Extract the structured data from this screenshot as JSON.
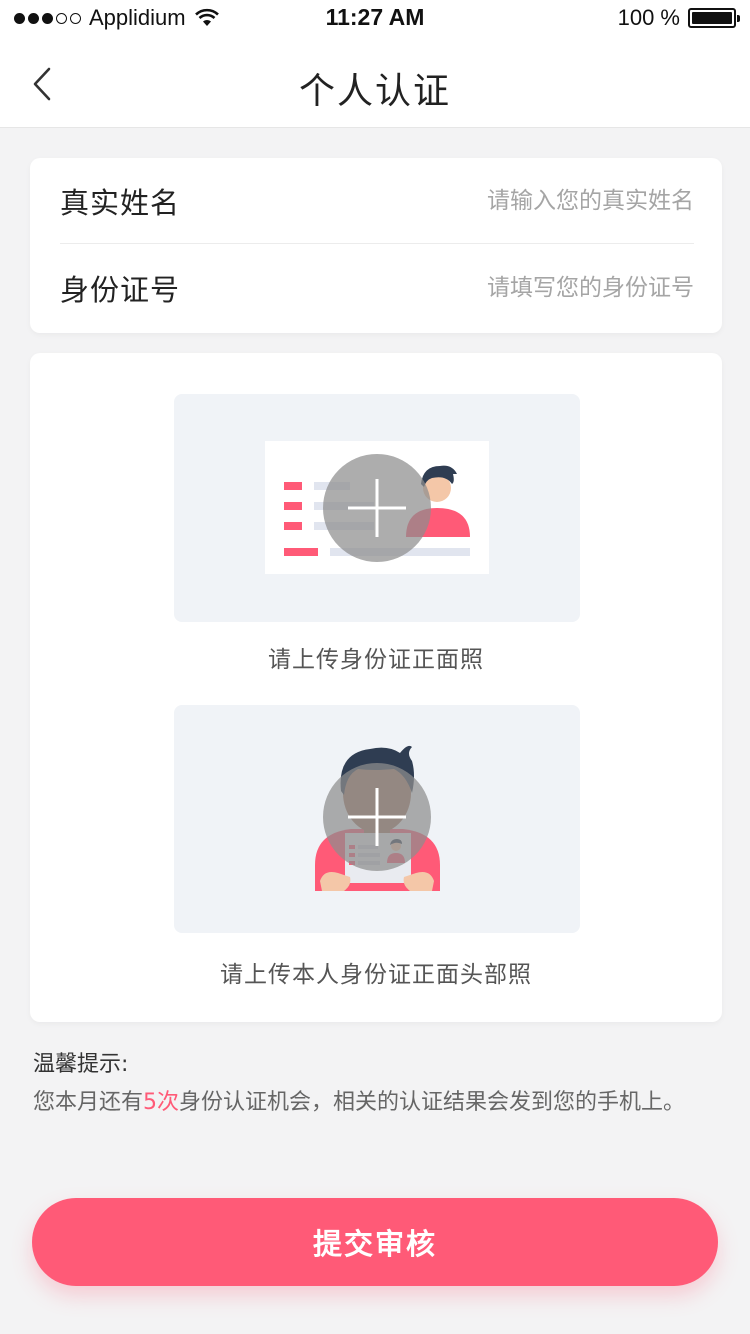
{
  "status_bar": {
    "carrier": "Applidium",
    "time": "11:27 AM",
    "battery": "100 %"
  },
  "nav": {
    "title": "个人认证"
  },
  "form": {
    "name_label": "真实姓名",
    "name_placeholder": "请输入您的真实姓名",
    "id_label": "身份证号",
    "id_placeholder": "请填写您的身份证号"
  },
  "uploads": [
    {
      "caption": "请上传身份证正面照",
      "icon": "id-card-front-icon"
    },
    {
      "caption": "请上传本人身份证正面头部照",
      "icon": "person-holding-id-icon"
    }
  ],
  "tip": {
    "title": "温馨提示:",
    "text_before": "您本月还有",
    "count": "5次",
    "text_after": "身份认证机会，相关的认证结果会发到您的手机上。"
  },
  "submit_label": "提交审核",
  "colors": {
    "accent": "#ff5a77",
    "upload_bg": "#f0f3f7",
    "page_bg": "#f3f3f4"
  }
}
